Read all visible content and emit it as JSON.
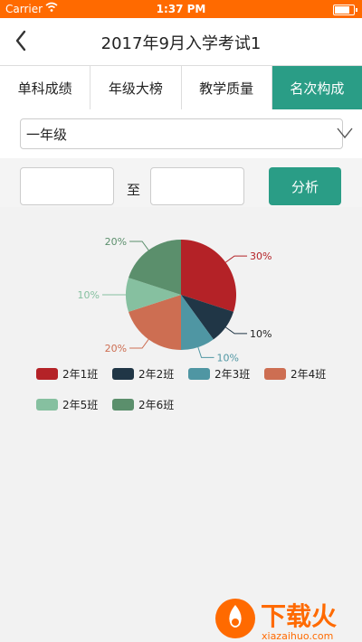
{
  "status_bar": {
    "carrier": "Carrier",
    "time": "1:37 PM",
    "battery_level": 0.9
  },
  "nav": {
    "title": "2017年9月入学考试1"
  },
  "tabs": [
    {
      "label": "单科成绩",
      "active": false
    },
    {
      "label": "年级大榜",
      "active": false
    },
    {
      "label": "教学质量",
      "active": false
    },
    {
      "label": "名次构成",
      "active": true
    }
  ],
  "grade_select": {
    "value": "一年级"
  },
  "range": {
    "separator": "至",
    "from_value": "",
    "to_value": "",
    "analyze_label": "分析"
  },
  "chart_data": {
    "type": "pie",
    "slices": [
      {
        "name": "2年1班",
        "value": 30,
        "label": "30%",
        "color": "#b42227"
      },
      {
        "name": "2年2班",
        "value": 10,
        "label": "10%",
        "color": "#203646"
      },
      {
        "name": "2年3班",
        "value": 10,
        "label": "10%",
        "color": "#4f96a3"
      },
      {
        "name": "2年4班",
        "value": 20,
        "label": "20%",
        "color": "#cd6e52"
      },
      {
        "name": "2年5班",
        "value": 10,
        "label": "10%",
        "color": "#86c0a0"
      },
      {
        "name": "2年6班",
        "value": 20,
        "label": "20%",
        "color": "#5b8f6c"
      }
    ],
    "legend_position": "bottom-left"
  },
  "watermark": {
    "brand": "下载火",
    "domain": "xiazaihuo.com"
  }
}
